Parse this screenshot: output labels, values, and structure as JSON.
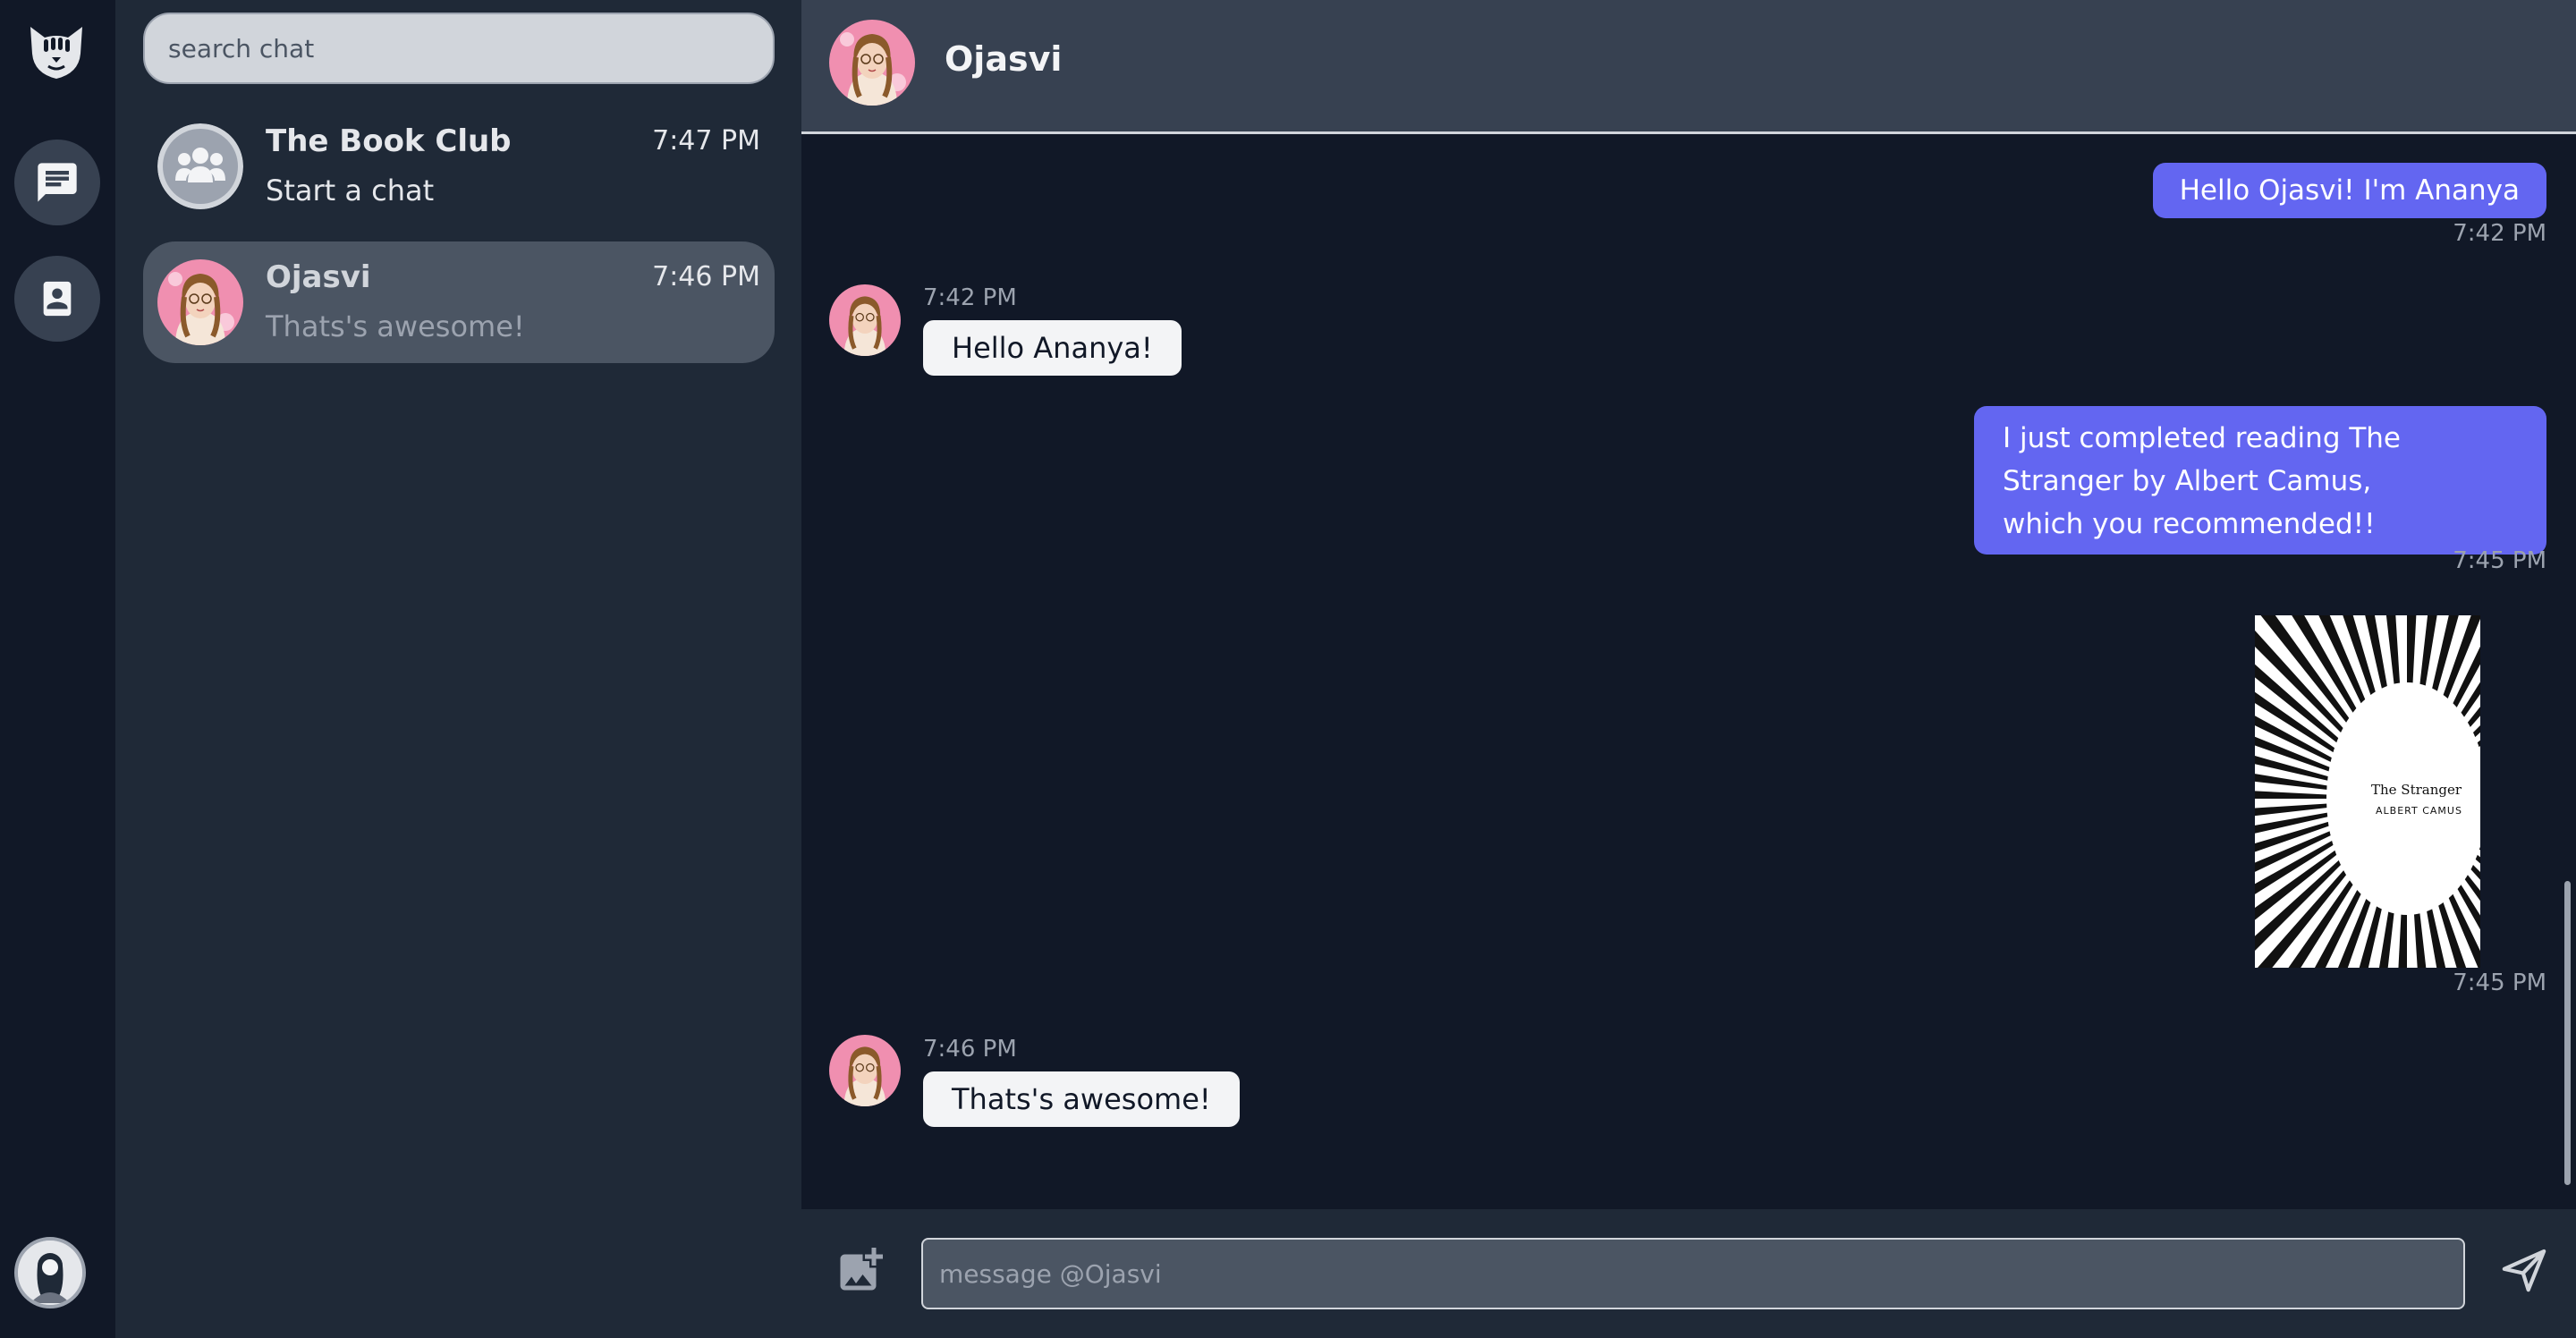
{
  "colors": {
    "rail_bg": "#111827",
    "panel_bg": "#1f2937",
    "header_bg": "#374151",
    "accent": "#6366f1",
    "incoming_bubble": "#f3f4f6",
    "selected_conversation": "#4b5563"
  },
  "rail": {
    "logo_icon": "cat-logo-icon",
    "nav": [
      {
        "icon": "chat-bubble-icon"
      },
      {
        "icon": "contact-book-icon"
      }
    ],
    "user_avatar_icon": "user-avatar"
  },
  "sidebar": {
    "search_placeholder": "search chat",
    "conversations": [
      {
        "name": "The Book Club",
        "time": "7:47 PM",
        "preview": "Start a chat",
        "avatar_icon": "group-icon"
      },
      {
        "name": "Ojasvi",
        "time": "7:46 PM",
        "preview": "Thats's awesome!",
        "avatar_icon": "user-avatar",
        "selected": true
      }
    ]
  },
  "chat": {
    "contact_name": "Ojasvi",
    "messages": [
      {
        "direction": "out",
        "text": "Hello Ojasvi! I'm Ananya",
        "time": "7:42 PM"
      },
      {
        "direction": "in",
        "text": "Hello Ananya!",
        "time": "7:42 PM"
      },
      {
        "direction": "out",
        "lines": [
          "I just completed reading The",
          "Stranger by Albert Camus,",
          "which you recommended!!"
        ],
        "time": "7:45 PM"
      },
      {
        "direction": "out",
        "type": "image",
        "image": {
          "title": "The Stranger",
          "author": "ALBERT CAMUS"
        },
        "time": "7:45 PM"
      },
      {
        "direction": "in",
        "text": "Thats's awesome!",
        "time": "7:46 PM"
      }
    ],
    "composer": {
      "placeholder": "message @Ojasvi",
      "attach_icon": "add-photo-icon",
      "send_icon": "send-icon"
    }
  }
}
